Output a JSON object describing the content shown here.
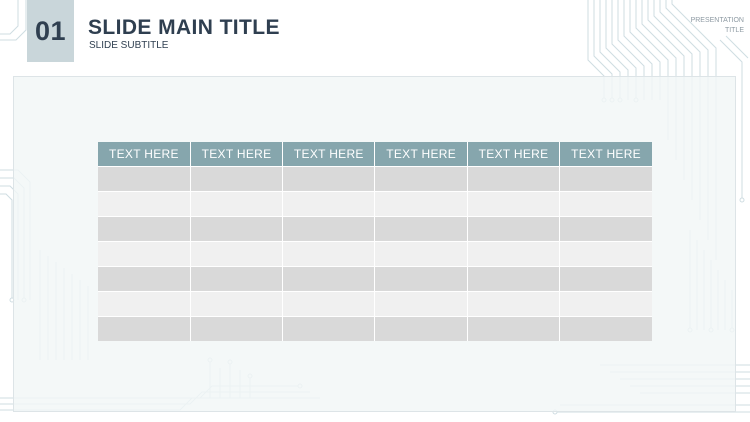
{
  "slide": {
    "number": "01",
    "title": "SLIDE MAIN TITLE",
    "subtitle": "SLIDE SUBTITLE",
    "presentation_title_line1": "PRESENTATION",
    "presentation_title_line2": "TITLE"
  },
  "table": {
    "headers": [
      "TEXT HERE",
      "TEXT HERE",
      "TEXT HERE",
      "TEXT HERE",
      "TEXT HERE",
      "TEXT HERE"
    ],
    "rows": [
      [
        "",
        "",
        "",
        "",
        "",
        ""
      ],
      [
        "",
        "",
        "",
        "",
        "",
        ""
      ],
      [
        "",
        "",
        "",
        "",
        "",
        ""
      ],
      [
        "",
        "",
        "",
        "",
        "",
        ""
      ],
      [
        "",
        "",
        "",
        "",
        "",
        ""
      ],
      [
        "",
        "",
        "",
        "",
        "",
        ""
      ],
      [
        "",
        "",
        "",
        "",
        "",
        ""
      ]
    ]
  },
  "colors": {
    "header_fill": "#86a6ad",
    "row_dark": "#d9d9d9",
    "row_light": "#f0f0f0",
    "title_text": "#2f3f50",
    "number_box": "#c9d6da"
  }
}
